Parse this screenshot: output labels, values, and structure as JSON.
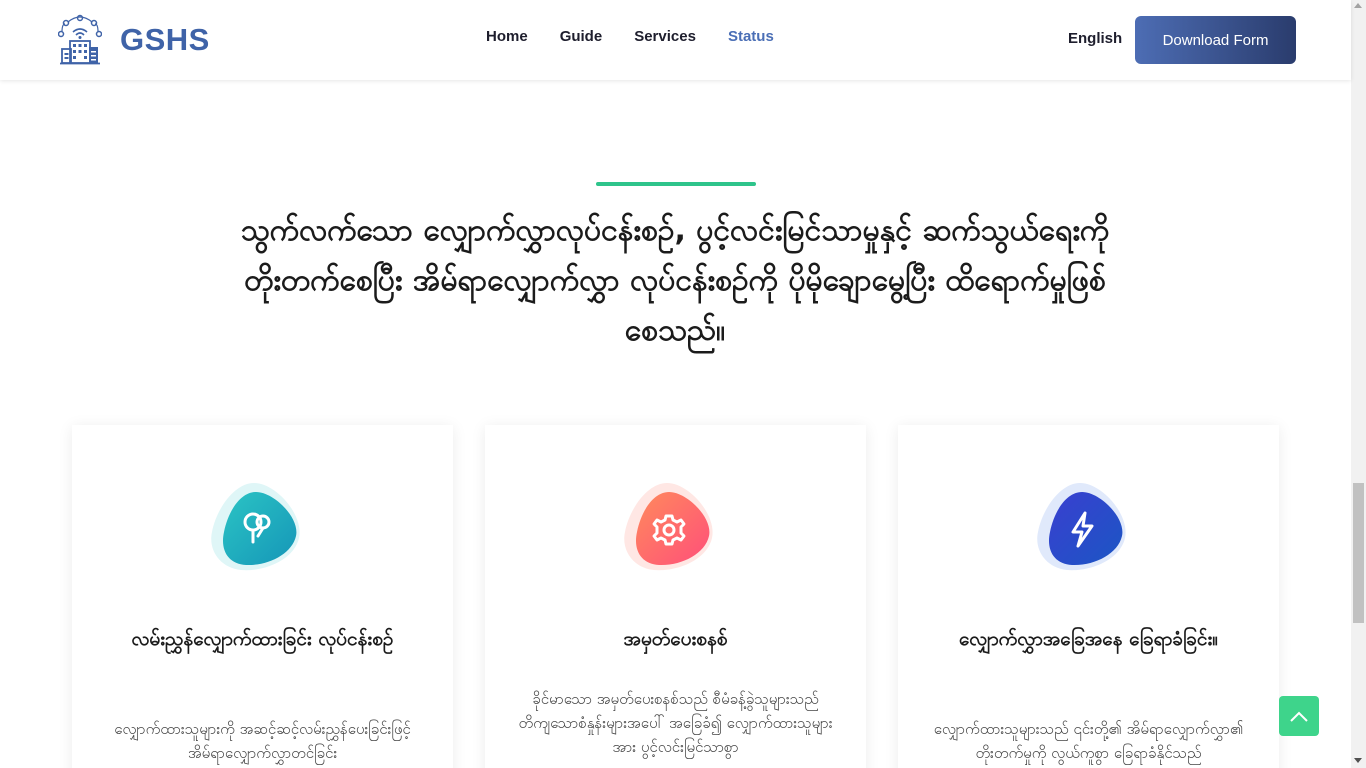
{
  "header": {
    "brand": "GSHS",
    "nav": [
      {
        "label": "Home",
        "active": false
      },
      {
        "label": "Guide",
        "active": false
      },
      {
        "label": "Services",
        "active": false
      },
      {
        "label": "Status",
        "active": true
      }
    ],
    "language": "English",
    "download_label": "Download Form"
  },
  "hero": {
    "headline_bold": "သွက်လက်သော လျှောက်လွှာလုပ်ငန်းစဉ်,",
    "headline_rest": " ပွင့်လင်းမြင်သာမှုနှင့် ဆက်သွယ်ရေးကို တိုးတက်စေပြီး အိမ်ရာလျှောက်လွှာ လုပ်ငန်းစဉ်ကို ပိုမိုချောမွေ့ပြီး ထိရောက်မှုဖြစ်စေသည်။"
  },
  "cards": [
    {
      "icon": "guide-icon",
      "title": "လမ်းညွှန်လျှောက်ထားခြင်း လုပ်ငန်းစဉ်",
      "desc": "လျှောက်ထားသူများကို အဆင့်ဆင့်လမ်းညွှန်ပေးခြင်းဖြင့် အိမ်ရာလျှောက်လွှာတင်ခြင်း"
    },
    {
      "icon": "gear-icon",
      "title": "အမှတ်ပေးစနစ်",
      "desc": "ခိုင်မာသော အမှတ်ပေးစနစ်သည် စီမံခန့်ခွဲသူများသည် တိကျသောစံနှုန်းများအပေါ် အခြေခံ၍ လျှောက်ထားသူများအား ပွင့်လင်းမြင်သာစွာ"
    },
    {
      "icon": "lightning-icon",
      "title": "လျှောက်လွှာအခြေအနေ ခြေရာခံခြင်း။",
      "desc": "လျှောက်ထားသူများသည် ၎င်းတို့၏ အိမ်ရာလျှောက်လွှာ၏ တိုးတက်မှုကို လွယ်ကူစွာ ခြေရာခံနိုင်သည်"
    }
  ],
  "colors": {
    "brand": "#3f63a8",
    "accent_line": "#2ec48b",
    "to_top": "#3ed48b"
  }
}
